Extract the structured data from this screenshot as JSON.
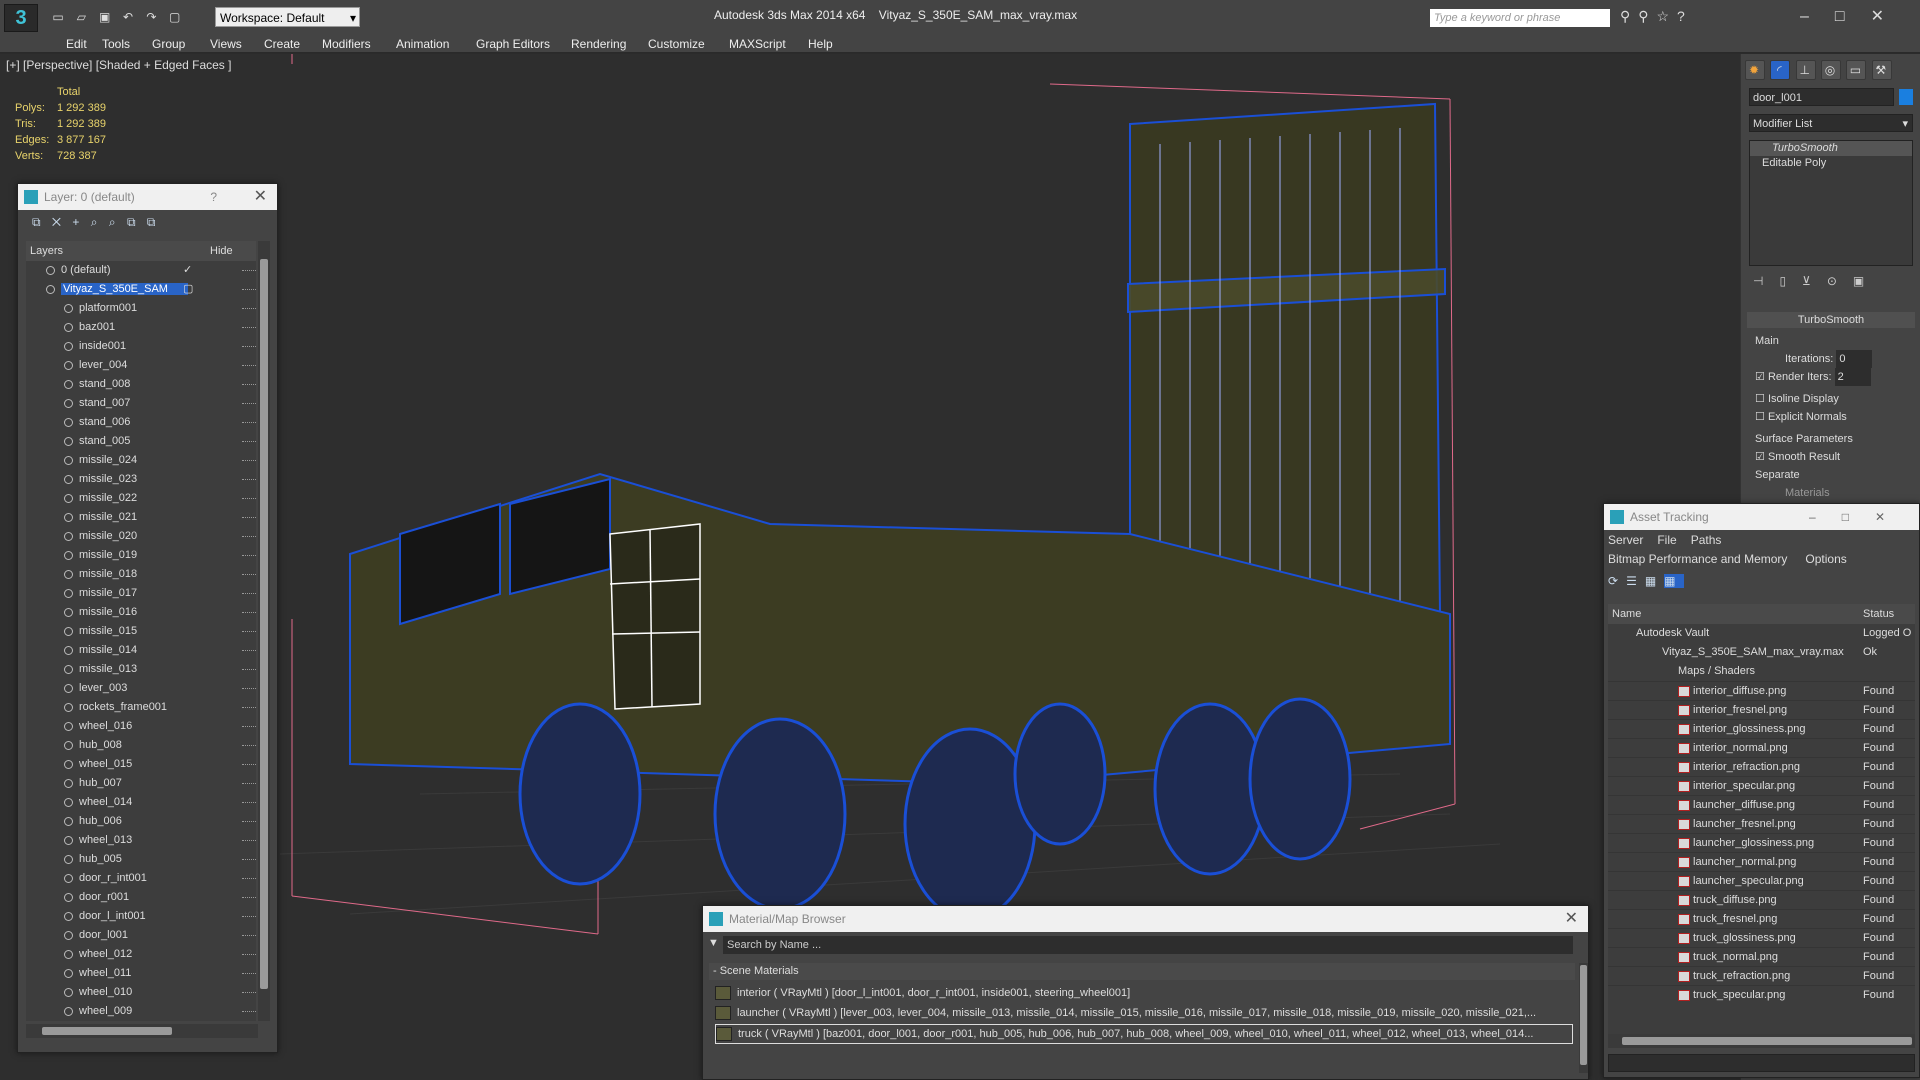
{
  "app": {
    "title": "Autodesk 3ds Max  2014 x64",
    "file": "Vityaz_S_350E_SAM_max_vray.max",
    "workspace": "Workspace: Default",
    "search_placeholder": "Type a keyword or phrase"
  },
  "menu": [
    "Edit",
    "Tools",
    "Group",
    "Views",
    "Create",
    "Modifiers",
    "Animation",
    "Graph Editors",
    "Rendering",
    "Customize",
    "MAXScript",
    "Help"
  ],
  "viewport": {
    "label": "[+] [Perspective] [Shaded + Edged Faces ]",
    "stats": {
      "header": "Total",
      "rows": [
        {
          "k": "Polys:",
          "v": "1 292 389"
        },
        {
          "k": "Tris:",
          "v": "1 292 389"
        },
        {
          "k": "Edges:",
          "v": "3 877 167"
        },
        {
          "k": "Verts:",
          "v": "728 387"
        }
      ]
    }
  },
  "layers": {
    "title": "Layer: 0 (default)",
    "help": "?",
    "col_layers": "Layers",
    "col_hide": "Hide",
    "items": [
      "0 (default)",
      "Vityaz_S_350E_SAM",
      "platform001",
      "baz001",
      "inside001",
      "lever_004",
      "stand_008",
      "stand_007",
      "stand_006",
      "stand_005",
      "missile_024",
      "missile_023",
      "missile_022",
      "missile_021",
      "missile_020",
      "missile_019",
      "missile_018",
      "missile_017",
      "missile_016",
      "missile_015",
      "missile_014",
      "missile_013",
      "lever_003",
      "rockets_frame001",
      "wheel_016",
      "hub_008",
      "wheel_015",
      "hub_007",
      "wheel_014",
      "hub_006",
      "wheel_013",
      "hub_005",
      "door_r_int001",
      "door_r001",
      "door_l_int001",
      "door_l001",
      "wheel_012",
      "wheel_011",
      "wheel_010",
      "wheel_009"
    ]
  },
  "command_panel": {
    "object_name": "door_l001",
    "modifier_list": "Modifier List",
    "stack": [
      "TurboSmooth",
      "Editable Poly"
    ],
    "rollout_title": "TurboSmooth",
    "main": "Main",
    "iterations_label": "Iterations:",
    "iterations": "0",
    "render_iters_label": "Render Iters:",
    "render_iters": "2",
    "isoline": "Isoline Display",
    "explicit": "Explicit Normals",
    "surface": "Surface Parameters",
    "smooth": "Smooth Result",
    "separate": "Separate",
    "materials": "Materials"
  },
  "asset": {
    "title": "Asset Tracking",
    "menu": [
      "Server",
      "File",
      "Paths"
    ],
    "menu2": [
      "Bitmap Performance and Memory",
      "Options"
    ],
    "col_name": "Name",
    "col_status": "Status",
    "vault": "Autodesk Vault",
    "vault_status": "Logged O",
    "file": "Vityaz_S_350E_SAM_max_vray.max",
    "file_status": "Ok",
    "maps": "Maps / Shaders",
    "items": [
      "interior_diffuse.png",
      "interior_fresnel.png",
      "interior_glossiness.png",
      "interior_normal.png",
      "interior_refraction.png",
      "interior_specular.png",
      "launcher_diffuse.png",
      "launcher_fresnel.png",
      "launcher_glossiness.png",
      "launcher_normal.png",
      "launcher_specular.png",
      "truck_diffuse.png",
      "truck_fresnel.png",
      "truck_glossiness.png",
      "truck_normal.png",
      "truck_refraction.png",
      "truck_specular.png"
    ],
    "found": "Found"
  },
  "material": {
    "title": "Material/Map Browser",
    "search": "Search by Name ...",
    "group": "- Scene Materials",
    "items": [
      "interior  ( VRayMtl ) [door_l_int001, door_r_int001, inside001, steering_wheel001]",
      "launcher  ( VRayMtl ) [lever_003, lever_004, missile_013, missile_014, missile_015, missile_016, missile_017, missile_018, missile_019, missile_020, missile_021,...",
      "truck  ( VRayMtl )  [baz001, door_l001, door_r001, hub_005, hub_006, hub_007, hub_008, wheel_009, wheel_010, wheel_011, wheel_012, wheel_013, wheel_014..."
    ]
  },
  "colors": {
    "wire": "#1a4fd6",
    "selection": "#2964c7",
    "stats": "#e8d36b"
  }
}
